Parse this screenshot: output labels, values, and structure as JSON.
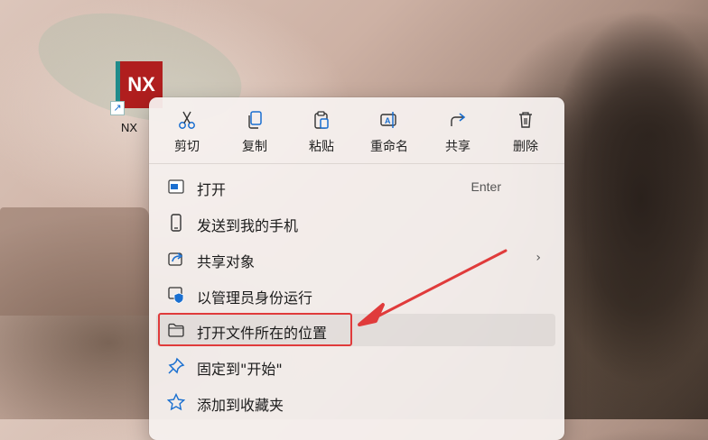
{
  "desktop": {
    "shortcut_tile_text": "NX",
    "shortcut_label": "NX"
  },
  "context_menu": {
    "toolbar": [
      {
        "label": "剪切",
        "icon": "scissors-icon"
      },
      {
        "label": "复制",
        "icon": "copy-icon"
      },
      {
        "label": "粘贴",
        "icon": "paste-icon"
      },
      {
        "label": "重命名",
        "icon": "rename-icon"
      },
      {
        "label": "共享",
        "icon": "share-icon"
      },
      {
        "label": "删除",
        "icon": "trash-icon"
      }
    ],
    "items": [
      {
        "label": "打开",
        "icon": "open-window-icon",
        "accelerator": "Enter"
      },
      {
        "label": "发送到我的手机",
        "icon": "phone-icon"
      },
      {
        "label": "共享对象",
        "icon": "share-object-icon",
        "has_submenu": true
      },
      {
        "label": "以管理员身份运行",
        "icon": "admin-shield-icon"
      },
      {
        "label": "打开文件所在的位置",
        "icon": "folder-icon",
        "highlighted": true
      },
      {
        "label": "固定到\"开始\"",
        "icon": "pin-icon"
      },
      {
        "label": "添加到收藏夹",
        "icon": "star-icon"
      }
    ]
  },
  "annotation": {
    "color": "#e03b3b"
  },
  "colors": {
    "icon_blue": "#1a6fd0",
    "highlight_red": "#e03b3b"
  }
}
